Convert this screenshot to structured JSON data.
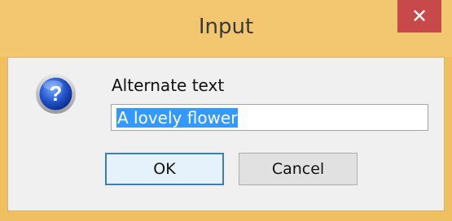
{
  "window": {
    "title": "Input",
    "close_glyph": "✕"
  },
  "dialog": {
    "icon": "question-icon",
    "prompt": "Alternate text",
    "input_value": "A lovely flower",
    "input_selected": true
  },
  "buttons": {
    "ok_label": "OK",
    "cancel_label": "Cancel"
  },
  "colors": {
    "frame": "#f3c670",
    "close": "#c74949",
    "selection": "#3399ff",
    "default_button_border": "#3c7fb1"
  }
}
